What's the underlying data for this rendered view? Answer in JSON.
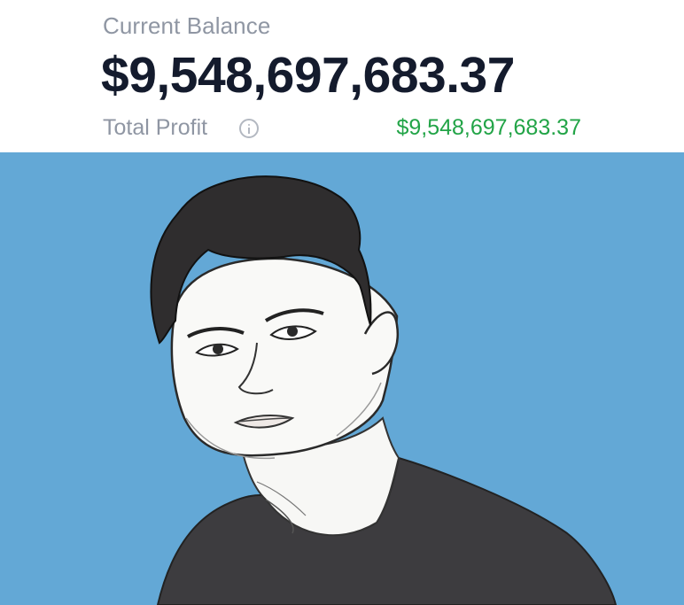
{
  "balance": {
    "label": "Current Balance",
    "amount": "$9,548,697,683.37"
  },
  "profit": {
    "label": "Total Profit",
    "value": "$9,548,697,683.37",
    "info_icon": "info-icon"
  },
  "colors": {
    "label_gray": "#8f96a3",
    "amount_dark": "#141b2d",
    "profit_green": "#22a447",
    "portrait_background": "#63a8d6",
    "shirt": "#3d3c3f",
    "hair": "#2f2d2e"
  }
}
